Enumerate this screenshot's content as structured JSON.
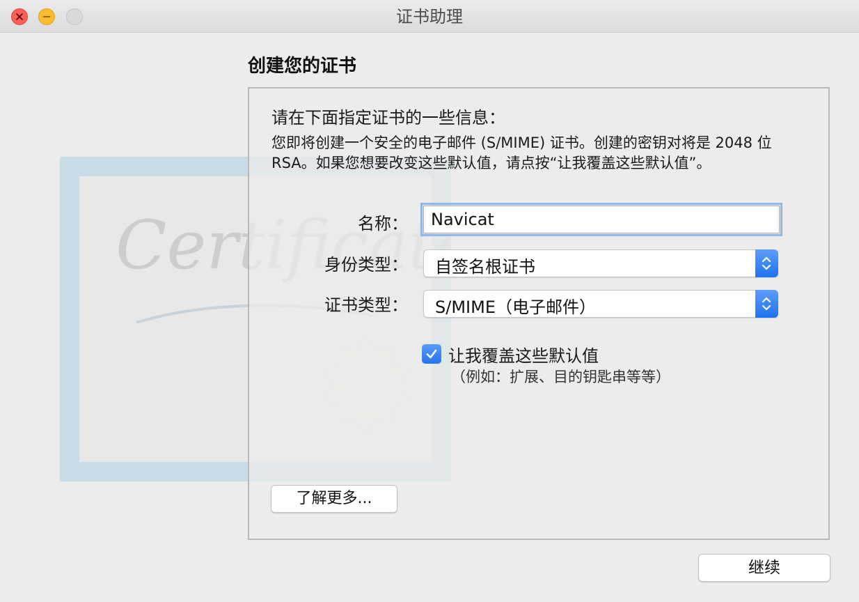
{
  "window": {
    "title": "证书助理"
  },
  "traffic_lights": {
    "close": "close-icon",
    "minimize": "minimize-icon",
    "zoom": "zoom-icon"
  },
  "background_art": {
    "watermark_text": "Certificate"
  },
  "page": {
    "heading": "创建您的证书"
  },
  "info": {
    "title": "请在下面指定证书的一些信息：",
    "description": "您即将创建一个安全的电子邮件 (S/MIME) 证书。创建的密钥对将是 2048 位 RSA。如果您想要改变这些默认值，请点按“让我覆盖这些默认值”。"
  },
  "form": {
    "name_label": "名称：",
    "name_value": "Navicat",
    "identity_type_label": "身份类型：",
    "identity_type_value": "自签名根证书",
    "cert_type_label": "证书类型：",
    "cert_type_value": "S/MIME（电子邮件）"
  },
  "override": {
    "checked": true,
    "label": "让我覆盖这些默认值",
    "hint": "（例如：扩展、目的钥匙串等等）"
  },
  "buttons": {
    "learn_more": "了解更多...",
    "continue": "继续"
  },
  "colors": {
    "accent": "#2474ee",
    "focus_ring": "#8fb7ea",
    "close": "#fc5f57",
    "minimize": "#fdbc2e"
  }
}
